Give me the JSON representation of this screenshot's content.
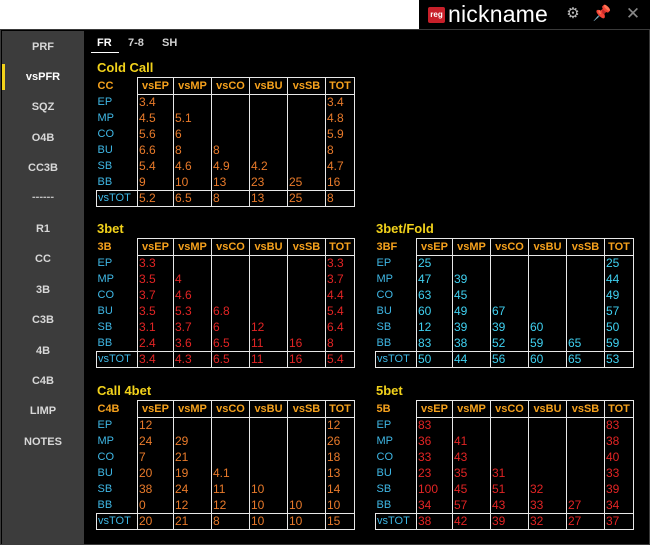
{
  "titlebar": {
    "icon_text": "reg",
    "name": "nickname"
  },
  "sidebar": {
    "items": [
      "PRF",
      "vsPFR",
      "SQZ",
      "O4B",
      "CC3B",
      "------",
      "R1",
      "CC",
      "3B",
      "C3B",
      "4B",
      "C4B",
      "LIMP",
      "NOTES"
    ],
    "active": "vsPFR"
  },
  "tabs": {
    "items": [
      "FR",
      "7-8",
      "SH"
    ],
    "active": "FR"
  },
  "colors": {
    "accent": "#f2d21b",
    "header": "#f5a11d",
    "row_label": "#3fb8e6",
    "orange": "#e87a2a",
    "red": "#e22424",
    "cyan": "#3fd0f0"
  },
  "headers": [
    "vsEP",
    "vsMP",
    "vsCO",
    "vsBU",
    "vsSB",
    "TOT"
  ],
  "rows": [
    "EP",
    "MP",
    "CO",
    "BU",
    "SB",
    "BB"
  ],
  "total_label": "vsTOT",
  "sections": [
    {
      "title": "Cold Call",
      "code": "CC",
      "cells": [
        [
          "3.4",
          "",
          "",
          "",
          "",
          "3.4"
        ],
        [
          "4.5",
          "5.1",
          "",
          "",
          "",
          "4.8"
        ],
        [
          "5.6",
          "6",
          "",
          "",
          "",
          "5.9"
        ],
        [
          "6.6",
          "8",
          "8",
          "",
          "",
          "8"
        ],
        [
          "5.4",
          "4.6",
          "4.9",
          "4.2",
          "",
          "4.7"
        ],
        [
          "9",
          "10",
          "13",
          "23",
          "25",
          "16"
        ]
      ],
      "totals": [
        "5.2",
        "6.5",
        "8",
        "13",
        "25",
        "8"
      ]
    },
    {
      "title": "3bet",
      "code": "3B",
      "cells": [
        [
          "3.3",
          "",
          "",
          "",
          "",
          "3.3"
        ],
        [
          "3.5",
          "4",
          "",
          "",
          "",
          "3.7"
        ],
        [
          "3.7",
          "4.6",
          "",
          "",
          "",
          "4.4"
        ],
        [
          "3.5",
          "5.3",
          "6.8",
          "",
          "",
          "5.4"
        ],
        [
          "3.1",
          "3.7",
          "6",
          "12",
          "",
          "6.4"
        ],
        [
          "2.4",
          "3.6",
          "6.5",
          "11",
          "16",
          "8"
        ]
      ],
      "totals": [
        "3.4",
        "4.3",
        "6.5",
        "11",
        "16",
        "5.4"
      ]
    },
    {
      "title": "3bet/Fold",
      "code": "3BF",
      "cells": [
        [
          "25",
          "",
          "",
          "",
          "",
          "25"
        ],
        [
          "47",
          "39",
          "",
          "",
          "",
          "44"
        ],
        [
          "63",
          "45",
          "",
          "",
          "",
          "49"
        ],
        [
          "60",
          "49",
          "67",
          "",
          "",
          "57"
        ],
        [
          "12",
          "39",
          "39",
          "60",
          "",
          "50"
        ],
        [
          "83",
          "38",
          "52",
          "59",
          "65",
          "59"
        ]
      ],
      "totals": [
        "50",
        "44",
        "56",
        "60",
        "65",
        "53"
      ]
    },
    {
      "title": "Call 4bet",
      "code": "C4B",
      "cells": [
        [
          "12",
          "",
          "",
          "",
          "",
          "12"
        ],
        [
          "24",
          "29",
          "",
          "",
          "",
          "26"
        ],
        [
          "7",
          "21",
          "",
          "",
          "",
          "18"
        ],
        [
          "20",
          "19",
          "4.1",
          "",
          "",
          "13"
        ],
        [
          "38",
          "24",
          "11",
          "10",
          "",
          "14"
        ],
        [
          "0",
          "12",
          "12",
          "10",
          "10",
          "10"
        ]
      ],
      "totals": [
        "20",
        "21",
        "8",
        "10",
        "10",
        "15"
      ]
    },
    {
      "title": "5bet",
      "code": "5B",
      "cells": [
        [
          "83",
          "",
          "",
          "",
          "",
          "83"
        ],
        [
          "36",
          "41",
          "",
          "",
          "",
          "38"
        ],
        [
          "33",
          "43",
          "",
          "",
          "",
          "40"
        ],
        [
          "23",
          "35",
          "31",
          "",
          "",
          "33"
        ],
        [
          "100",
          "45",
          "51",
          "32",
          "",
          "39"
        ],
        [
          "34",
          "57",
          "43",
          "33",
          "27",
          "34"
        ]
      ],
      "totals": [
        "38",
        "42",
        "39",
        "32",
        "27",
        "37"
      ]
    }
  ]
}
